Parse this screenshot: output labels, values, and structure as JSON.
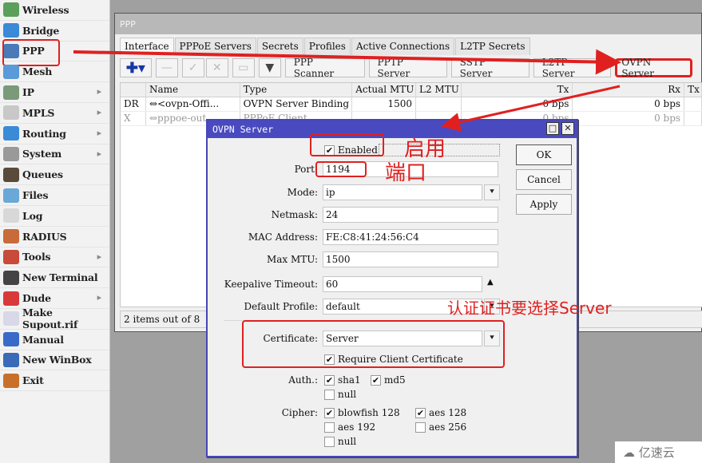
{
  "sidebar": {
    "items": [
      {
        "label": "Wireless",
        "icon": "wireless-icon",
        "submenu": false
      },
      {
        "label": "Bridge",
        "icon": "bridge-icon",
        "submenu": false
      },
      {
        "label": "PPP",
        "icon": "ppp-icon",
        "submenu": false,
        "highlighted": true
      },
      {
        "label": "Mesh",
        "icon": "mesh-icon",
        "submenu": false
      },
      {
        "label": "IP",
        "icon": "ip-icon",
        "submenu": true
      },
      {
        "label": "MPLS",
        "icon": "mpls-icon",
        "submenu": true
      },
      {
        "label": "Routing",
        "icon": "routing-icon",
        "submenu": true
      },
      {
        "label": "System",
        "icon": "system-gear-icon",
        "submenu": true
      },
      {
        "label": "Queues",
        "icon": "queues-icon",
        "submenu": false
      },
      {
        "label": "Files",
        "icon": "folder-icon",
        "submenu": false
      },
      {
        "label": "Log",
        "icon": "log-icon",
        "submenu": false
      },
      {
        "label": "RADIUS",
        "icon": "radius-users-icon",
        "submenu": false
      },
      {
        "label": "Tools",
        "icon": "tools-icon",
        "submenu": true
      },
      {
        "label": "New Terminal",
        "icon": "terminal-icon",
        "submenu": false
      },
      {
        "label": "Dude",
        "icon": "dude-icon",
        "submenu": true
      },
      {
        "label": "Make Supout.rif",
        "icon": "supout-file-icon",
        "submenu": false
      },
      {
        "label": "Manual",
        "icon": "help-icon",
        "submenu": false
      },
      {
        "label": "New WinBox",
        "icon": "winbox-icon",
        "submenu": false
      },
      {
        "label": "Exit",
        "icon": "exit-door-icon",
        "submenu": false
      }
    ],
    "submenu_arrow": "▸"
  },
  "ppp_window": {
    "title": "PPP",
    "tabs": [
      "Interface",
      "PPPoE Servers",
      "Secrets",
      "Profiles",
      "Active Connections",
      "L2TP Secrets"
    ],
    "active_tab": "Interface",
    "toolbar": {
      "add": "✚▾",
      "remove": "—",
      "enable": "✓",
      "disable": "✕",
      "comment": "▭",
      "filter": "▼",
      "buttons": [
        "PPP Scanner",
        "PPTP Server",
        "SSTP Server",
        "L2TP Server",
        "OVPN Server"
      ]
    },
    "columns": [
      "",
      "Name",
      "Type",
      "Actual MTU",
      "L2 MTU",
      "Tx",
      "Rx",
      "Tx"
    ],
    "rows": [
      {
        "flags": "DR",
        "name": "⇔<ovpn-Offi...",
        "type": "OVPN Server Binding",
        "actual_mtu": "1500",
        "l2_mtu": "",
        "tx": "0 bps",
        "rx": "0 bps",
        "disabled": false
      },
      {
        "flags": "X",
        "name": "⇔pppoe-out",
        "type": "PPPoE Client",
        "actual_mtu": "",
        "l2_mtu": "",
        "tx": "0 bps",
        "rx": "0 bps",
        "disabled": true
      }
    ],
    "status": "2 items out of 8"
  },
  "dialog": {
    "title": "OVPN Server",
    "enabled_label": "Enabled",
    "enabled": true,
    "fields": {
      "port": {
        "label": "Port:",
        "value": "1194"
      },
      "mode": {
        "label": "Mode:",
        "value": "ip"
      },
      "netmask": {
        "label": "Netmask:",
        "value": "24"
      },
      "mac": {
        "label": "MAC Address:",
        "value": "FE:C8:41:24:56:C4"
      },
      "max_mtu": {
        "label": "Max MTU:",
        "value": "1500"
      },
      "keepalive": {
        "label": "Keepalive Timeout:",
        "value": "60"
      },
      "profile": {
        "label": "Default Profile:",
        "value": "default"
      },
      "certificate": {
        "label": "Certificate:",
        "value": "Server"
      }
    },
    "require_client_cert": {
      "label": "Require Client Certificate",
      "checked": true
    },
    "auth": {
      "label": "Auth.:",
      "options": [
        {
          "label": "sha1",
          "checked": true
        },
        {
          "label": "md5",
          "checked": true
        },
        {
          "label": "null",
          "checked": false
        }
      ]
    },
    "cipher": {
      "label": "Cipher:",
      "options": [
        {
          "label": "blowfish 128",
          "checked": true
        },
        {
          "label": "aes 128",
          "checked": true
        },
        {
          "label": "aes 192",
          "checked": false
        },
        {
          "label": "aes 256",
          "checked": false
        },
        {
          "label": "null",
          "checked": false
        }
      ]
    },
    "buttons": {
      "ok": "OK",
      "cancel": "Cancel",
      "apply": "Apply"
    },
    "check_mark": "✔",
    "dropdown_glyph": "⯆",
    "spinner_glyph": "▲"
  },
  "annotations": {
    "enable": "启用",
    "port": "端口",
    "certificate": "认证证书要选择Server",
    "color": "#e02020"
  },
  "watermark": "亿速云"
}
